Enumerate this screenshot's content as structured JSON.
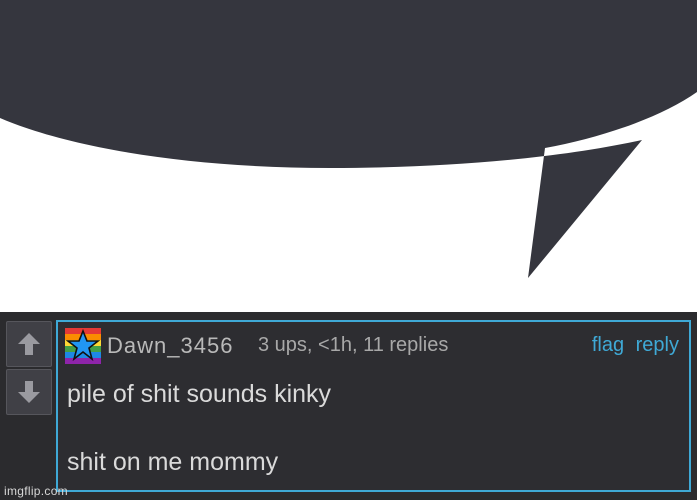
{
  "comment": {
    "username": "Dawn_3456",
    "meta": "3 ups, <1h, 11 replies",
    "flag_label": "flag",
    "reply_label": "reply",
    "lines": [
      "pile of shit sounds kinky",
      "shit on me mommy"
    ]
  },
  "icons": {
    "upvote": "arrow-up-icon",
    "downvote": "arrow-down-icon",
    "avatar": "rainbow-star-avatar"
  },
  "watermark": "imgflip.com",
  "colors": {
    "bubble": "#35363e",
    "accent": "#3fa9d6",
    "panel": "#2b2b2e"
  }
}
